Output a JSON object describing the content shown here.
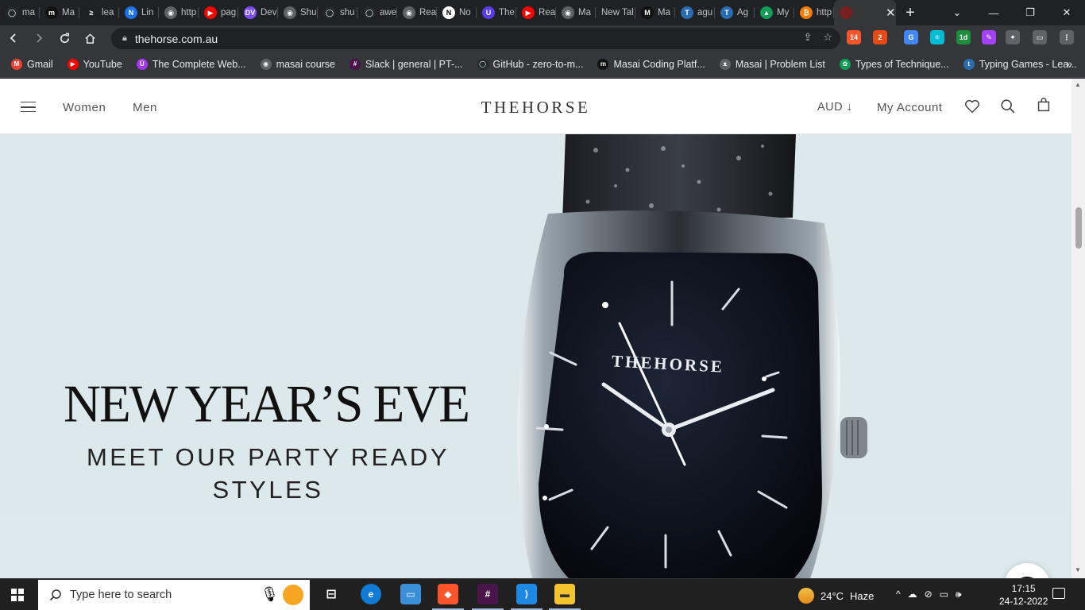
{
  "browser": {
    "tabs": [
      {
        "title": "ma",
        "color": "#24292e",
        "glyph": "◯"
      },
      {
        "title": "Ma",
        "color": "#111111",
        "glyph": "m"
      },
      {
        "title": "lea",
        "color": "#202124",
        "glyph": "≥"
      },
      {
        "title": "Lin",
        "color": "#1a73e8",
        "glyph": "N"
      },
      {
        "title": "http",
        "color": "#5f6368",
        "glyph": "◉"
      },
      {
        "title": "pag",
        "color": "#ff0000",
        "glyph": "▶"
      },
      {
        "title": "Dev",
        "color": "#7c4dff",
        "glyph": "DV"
      },
      {
        "title": "Shu",
        "color": "#5f6368",
        "glyph": "◉"
      },
      {
        "title": "shu",
        "color": "#24292e",
        "glyph": "◯"
      },
      {
        "title": "awe",
        "color": "#24292e",
        "glyph": "◯"
      },
      {
        "title": "Rea",
        "color": "#5f6368",
        "glyph": "◉"
      },
      {
        "title": "No",
        "color": "#ffffff",
        "glyph": "N"
      },
      {
        "title": "The",
        "color": "#5a3cf0",
        "glyph": "U"
      },
      {
        "title": "Rea",
        "color": "#ff0000",
        "glyph": "▶"
      },
      {
        "title": "Ma",
        "color": "#5f6368",
        "glyph": "◉"
      },
      {
        "title": "New Tab",
        "color": "",
        "glyph": ""
      },
      {
        "title": "Ma",
        "color": "#111111",
        "glyph": "M"
      },
      {
        "title": "agu",
        "color": "#2b6cb0",
        "glyph": "T"
      },
      {
        "title": "Ag",
        "color": "#2b6cb0",
        "glyph": "T"
      },
      {
        "title": "My",
        "color": "#0f9d58",
        "glyph": "▲"
      },
      {
        "title": "http",
        "color": "#f57c00",
        "glyph": "₿"
      }
    ],
    "active_tab": {
      "title": "",
      "color": "#7a1f1f"
    },
    "new_tab_label": "+",
    "window_controls": {
      "minimize": "—",
      "maximize": "❐",
      "close": "✕"
    },
    "url": "thehorse.com.au",
    "extensions": [
      {
        "label": "14",
        "color": "#fb542b"
      },
      {
        "label": "2",
        "color": "#e64a19"
      },
      {
        "label": "G",
        "color": "#4285f4"
      },
      {
        "label": "⚛",
        "color": "#00bcd4"
      },
      {
        "label": "1d",
        "color": "#1e8e3e"
      },
      {
        "label": "✎",
        "color": "#a142f4"
      },
      {
        "label": "✦",
        "color": "#5f6368"
      },
      {
        "label": "▭",
        "color": "#5f6368"
      },
      {
        "label": "⋮",
        "color": "#5f6368"
      }
    ],
    "bookmarks": [
      {
        "label": "Gmail",
        "color": "#ea4335",
        "glyph": "M"
      },
      {
        "label": "YouTube",
        "color": "#ff0000",
        "glyph": "▶"
      },
      {
        "label": "The Complete Web...",
        "color": "#a435f0",
        "glyph": "Ü"
      },
      {
        "label": "masai course",
        "color": "#5f6368",
        "glyph": "◉"
      },
      {
        "label": "Slack | general | PT-...",
        "color": "#4a154b",
        "glyph": "#"
      },
      {
        "label": "GitHub - zero-to-m...",
        "color": "#24292e",
        "glyph": "◯"
      },
      {
        "label": "Masai Coding Platf...",
        "color": "#111111",
        "glyph": "m"
      },
      {
        "label": "Masai | Problem List",
        "color": "#5f6368",
        "glyph": "ᴥ"
      },
      {
        "label": "Types of Technique...",
        "color": "#0f9d58",
        "glyph": "✿"
      },
      {
        "label": "Typing Games - Lea...",
        "color": "#2b6cb0",
        "glyph": "t"
      }
    ],
    "bookmarks_more": "»"
  },
  "site": {
    "nav": {
      "women": "Women",
      "men": "Men"
    },
    "logo": "THEHORSE",
    "currency": "AUD ↓",
    "account": "My Account",
    "hero": {
      "title": "NEW YEAR’S EVE",
      "subtitle": "MEET OUR PARTY READY STYLES",
      "watch_brand": "THEHORSE"
    }
  },
  "taskbar": {
    "search_placeholder": "Type here to search",
    "weather": {
      "temp": "24°C",
      "condition": "Haze"
    },
    "clock": {
      "time": "17:15",
      "date": "24-12-2022"
    },
    "tray_icons": [
      "^",
      "☁",
      "⊘",
      "▭",
      "🕪"
    ]
  }
}
